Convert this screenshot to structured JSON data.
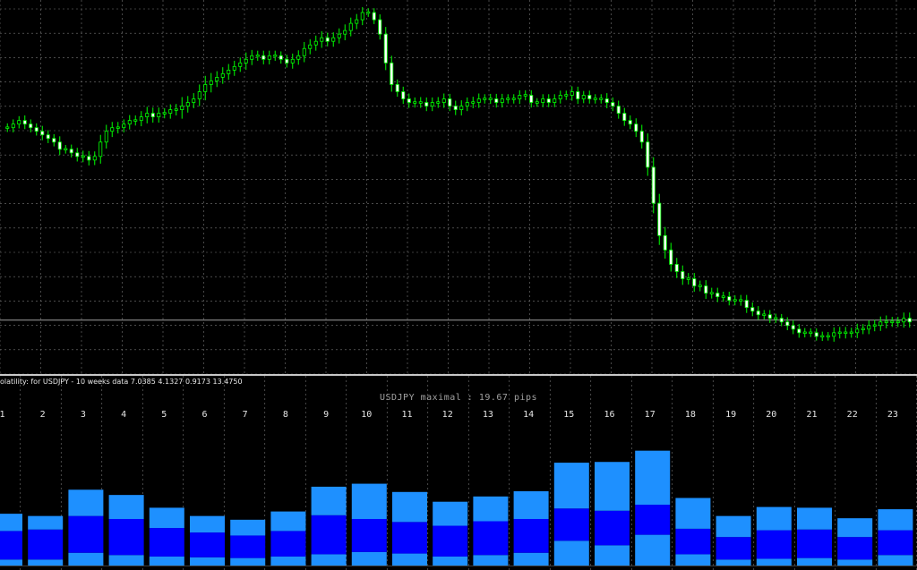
{
  "colors": {
    "background": "#000000",
    "grid": "#787878",
    "candle": "#00ff00",
    "candle_body": "#ffffff",
    "level_line": "#a0a0a0",
    "bar_light": "#1e90ff",
    "bar_dark": "#0000ff",
    "text": "#e6e6e6",
    "title_text": "#a0a0a0"
  },
  "indicator": {
    "label": "olatility: for USDJPY - 10 weeks data  7.0385 4.1327 0.9173 13.4750",
    "title": "USDJPY maximal : 19.67 pips"
  },
  "chart_data": [
    {
      "type": "candlestick",
      "symbol": "USDJPY",
      "note_units": "relative price scale 0-100 (no price axis printed)",
      "ylim": [
        0,
        100
      ],
      "grid": true,
      "horizontal_level": 12.5,
      "close": [
        66,
        67,
        68,
        67,
        66,
        65,
        64,
        63,
        62,
        60,
        60,
        59,
        58,
        58,
        57,
        58,
        62,
        65,
        66,
        66,
        67,
        68,
        68,
        69,
        70,
        69,
        70,
        70,
        71,
        71,
        72,
        73,
        74,
        76,
        78,
        79,
        80,
        81,
        82,
        83,
        84,
        85,
        86,
        86,
        85,
        86,
        86,
        85,
        84,
        85,
        86,
        88,
        89,
        90,
        91,
        90,
        91,
        92,
        93,
        95,
        96,
        98,
        98,
        96,
        92,
        84,
        78,
        76,
        74,
        73,
        73,
        73,
        72,
        73,
        73,
        74,
        72,
        71,
        72,
        73,
        73,
        74,
        74,
        74,
        73,
        74,
        74,
        74,
        75,
        75,
        73,
        73,
        74,
        73,
        74,
        75,
        75,
        76,
        74,
        75,
        74,
        74,
        74,
        73,
        72,
        70,
        68,
        67,
        65,
        62,
        55,
        45,
        36,
        32,
        28,
        26,
        24,
        24,
        22,
        22,
        20,
        20,
        19,
        19,
        18,
        18,
        18,
        16,
        15,
        14,
        14,
        13,
        13,
        12,
        11,
        10,
        9,
        9,
        9,
        8,
        8,
        8,
        9,
        9,
        9,
        9,
        10,
        10,
        11,
        11,
        12,
        12,
        12,
        12,
        13,
        12
      ],
      "high_offset": [
        1.2,
        1.3,
        1.2,
        1.4,
        1.3,
        1.2,
        1.5,
        1.3,
        1.2,
        1.6,
        1.2,
        1.3,
        1.4,
        1.6,
        1.5,
        1.4,
        2.0,
        1.8,
        1.6,
        1.6,
        1.3,
        1.5,
        1.4,
        1.6,
        1.8,
        1.6,
        1.6,
        1.4,
        1.5,
        1.6,
        2.5,
        1.8,
        1.6,
        2.0,
        2.4,
        2.2,
        1.7,
        1.8,
        1.7,
        1.6,
        1.5,
        1.9,
        1.6,
        1.4,
        1.4,
        1.4,
        1.4,
        1.2,
        1.3,
        1.6,
        1.5,
        1.8,
        1.6,
        1.6,
        1.8,
        1.4,
        1.5,
        1.6,
        1.7,
        1.6,
        1.6,
        1.5,
        1.2,
        1.2,
        1.5,
        2.0,
        2.0,
        1.4,
        1.4,
        1.5,
        1.4,
        1.5,
        1.4,
        1.4,
        1.5,
        1.5,
        1.4,
        1.5,
        1.6,
        1.4,
        1.6,
        1.5,
        1.3,
        1.4,
        1.4,
        1.4,
        1.3,
        1.3,
        1.4,
        1.4,
        1.4,
        1.2,
        1.3,
        1.3,
        1.3,
        1.3,
        1.3,
        1.5,
        1.4,
        1.2,
        1.3,
        1.3,
        1.3,
        1.6,
        1.4,
        1.5,
        1.5,
        1.4,
        1.6,
        1.8,
        2.4,
        2.8,
        2.6,
        2.4,
        2.0,
        1.8,
        1.7,
        1.6,
        1.6,
        1.5,
        1.6,
        1.5,
        1.5,
        1.4,
        1.4,
        1.4,
        1.5,
        1.5,
        1.4,
        1.4,
        1.3,
        1.3,
        1.3,
        1.2,
        1.3,
        1.4,
        1.4,
        1.3,
        1.2,
        1.2,
        1.3,
        1.2,
        1.5,
        1.6,
        1.6,
        1.4,
        1.5,
        1.4,
        1.4,
        1.6,
        1.5,
        1.8,
        1.4,
        1.4,
        1.6,
        1.6
      ],
      "low_offset": [
        1.2,
        1.3,
        1.2,
        1.4,
        1.3,
        1.2,
        1.5,
        1.3,
        1.2,
        1.6,
        1.2,
        1.3,
        1.4,
        1.6,
        1.5,
        1.4,
        2.0,
        1.8,
        1.6,
        1.6,
        1.3,
        1.5,
        1.4,
        1.6,
        1.8,
        1.6,
        1.6,
        1.4,
        1.5,
        1.6,
        2.5,
        1.8,
        1.6,
        2.0,
        2.4,
        2.2,
        1.7,
        1.8,
        1.7,
        1.6,
        1.5,
        1.9,
        1.6,
        1.4,
        1.4,
        1.4,
        1.4,
        1.2,
        1.3,
        1.6,
        1.5,
        1.8,
        1.6,
        1.6,
        1.8,
        1.4,
        1.5,
        1.6,
        1.7,
        1.6,
        1.6,
        1.5,
        1.2,
        1.2,
        1.5,
        2.0,
        2.0,
        1.4,
        1.4,
        1.5,
        1.4,
        1.5,
        1.4,
        1.4,
        1.5,
        1.5,
        1.4,
        1.5,
        1.6,
        1.4,
        1.6,
        1.5,
        1.3,
        1.4,
        1.4,
        1.4,
        1.3,
        1.3,
        1.4,
        1.4,
        1.4,
        1.2,
        1.3,
        1.3,
        1.3,
        1.3,
        1.3,
        1.5,
        1.4,
        1.2,
        1.3,
        1.3,
        1.3,
        1.6,
        1.4,
        1.5,
        1.5,
        1.4,
        1.6,
        1.8,
        2.4,
        2.8,
        2.6,
        2.4,
        2.0,
        1.8,
        1.7,
        1.6,
        1.6,
        1.5,
        1.6,
        1.5,
        1.5,
        1.4,
        1.4,
        1.4,
        1.5,
        1.5,
        1.4,
        1.4,
        1.3,
        1.3,
        1.3,
        1.2,
        1.3,
        1.4,
        1.4,
        1.3,
        1.2,
        1.2,
        1.3,
        1.2,
        1.5,
        1.6,
        1.6,
        1.4,
        1.5,
        1.4,
        1.4,
        1.6,
        1.5,
        1.8,
        1.4,
        1.4,
        1.6,
        1.6
      ]
    },
    {
      "type": "bar",
      "title": "USDJPY maximal : 19.67 pips",
      "categories": [
        "1",
        "2",
        "3",
        "4",
        "5",
        "6",
        "7",
        "8",
        "9",
        "10",
        "11",
        "12",
        "13",
        "14",
        "15",
        "16",
        "17",
        "18",
        "19",
        "20",
        "21",
        "22",
        "23"
      ],
      "ylim": [
        0,
        19.67
      ],
      "series": [
        {
          "values": [
            2.3,
            1.8,
            3.5,
            3.2,
            2.7,
            2.2,
            2.1,
            2.6,
            3.8,
            4.7,
            4.0,
            3.2,
            3.3,
            3.7,
            6.1,
            6.5,
            7.2,
            4.1,
            2.8,
            3.1,
            2.9,
            2.5,
            2.8
          ]
        },
        {
          "values": [
            3.8,
            4.0,
            4.9,
            4.8,
            3.8,
            3.3,
            3.0,
            3.4,
            5.2,
            4.4,
            4.2,
            4.1,
            4.5,
            4.5,
            4.3,
            4.6,
            4.0,
            3.4,
            3.0,
            3.8,
            3.8,
            3.0,
            3.3
          ]
        },
        {
          "values": [
            0.8,
            0.8,
            1.7,
            1.4,
            1.2,
            1.1,
            1.0,
            1.2,
            1.5,
            1.8,
            1.6,
            1.2,
            1.4,
            1.7,
            3.3,
            2.7,
            4.1,
            1.5,
            0.8,
            0.9,
            1.0,
            0.8,
            1.4
          ]
        }
      ]
    }
  ]
}
